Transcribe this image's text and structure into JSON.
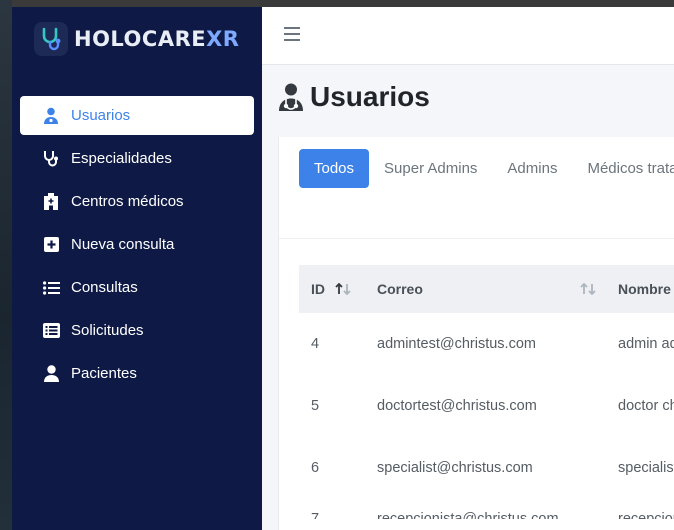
{
  "brand": {
    "name_main": "HOLOCARE",
    "name_accent": "XR",
    "accent_color": "#7fa8ff"
  },
  "colors": {
    "sidebar": "#0e1a45",
    "primary": "#3d82e8",
    "content_bg": "#f4f6f9"
  },
  "sidebar": {
    "items": [
      {
        "label": "Usuarios",
        "icon": "user-doctor-icon",
        "active": true
      },
      {
        "label": "Especialidades",
        "icon": "stethoscope-icon",
        "active": false
      },
      {
        "label": "Centros médicos",
        "icon": "hospital-icon",
        "active": false
      },
      {
        "label": "Nueva consulta",
        "icon": "plus-square-icon",
        "active": false
      },
      {
        "label": "Consultas",
        "icon": "list-icon",
        "active": false
      },
      {
        "label": "Solicitudes",
        "icon": "list-alt-icon",
        "active": false
      },
      {
        "label": "Pacientes",
        "icon": "user-icon",
        "active": false
      }
    ]
  },
  "header": {
    "menu_icon": "hamburger-icon"
  },
  "page": {
    "title": "Usuarios",
    "icon": "user-doctor-icon"
  },
  "tabs": [
    {
      "label": "Todos",
      "active": true
    },
    {
      "label": "Super Admins",
      "active": false
    },
    {
      "label": "Admins",
      "active": false
    },
    {
      "label": "Médicos tratantes",
      "active": false
    }
  ],
  "table": {
    "columns": [
      "ID",
      "Correo",
      "Nombre"
    ],
    "rows": [
      {
        "id": "4",
        "correo": "admintest@christus.com",
        "nombre": "admin admin"
      },
      {
        "id": "5",
        "correo": "doctortest@christus.com",
        "nombre": "doctor christus"
      },
      {
        "id": "6",
        "correo": "specialist@christus.com",
        "nombre": "specialist christus"
      },
      {
        "id": "7",
        "correo": "recepcionista@christus.com",
        "nombre": "recepcionista christus"
      }
    ]
  }
}
